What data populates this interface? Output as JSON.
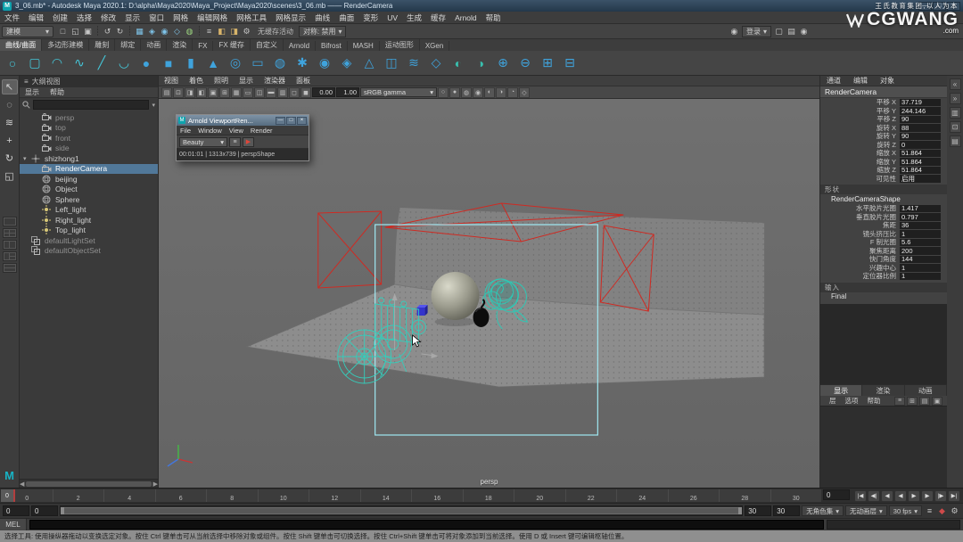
{
  "window": {
    "title": "3_06.mb* - Autodesk Maya 2020.1: D:\\alpha\\Maya2020\\Maya_Project\\Maya2020\\scenes\\3_06.mb —— RenderCamera",
    "badge": "M",
    "buttons": [
      {
        "name": "minimize-button",
        "glyph": "—"
      },
      {
        "name": "maximize-button",
        "glyph": "□"
      },
      {
        "name": "close-button",
        "glyph": "×"
      }
    ]
  },
  "watermark": {
    "line1": "王氏教育集团,以人为本",
    "brand": "CGWANG",
    "domain": ".com"
  },
  "menubar": {
    "items": [
      "文件",
      "编辑",
      "创建",
      "选择",
      "修改",
      "显示",
      "窗口",
      "网格",
      "编辑网格",
      "网格工具",
      "网格显示",
      "曲线",
      "曲面",
      "变形",
      "UV",
      "生成",
      "缓存",
      "Arnold",
      "帮助"
    ]
  },
  "statusline": {
    "mode": "建模",
    "no_cache_label": "无缓存活动",
    "symmetry_label": "对称: 禁用",
    "signin_label": "登录",
    "icons": [
      {
        "name": "new-scene-icon",
        "glyph": "□"
      },
      {
        "name": "open-scene-icon",
        "glyph": "◱"
      },
      {
        "name": "save-scene-icon",
        "glyph": "▣"
      },
      {
        "name": "separator-grip",
        "glyph": "┊"
      },
      {
        "name": "undo-icon",
        "glyph": "↺"
      },
      {
        "name": "redo-icon",
        "glyph": "↻"
      },
      {
        "name": "separator-grip",
        "glyph": "┊"
      },
      {
        "name": "snap-to-grid-icon",
        "glyph": "▦",
        "color": "#7ec3e8"
      },
      {
        "name": "snap-to-curve-icon",
        "glyph": "◈",
        "color": "#7ec3e8"
      },
      {
        "name": "snap-to-point-icon",
        "glyph": "◉",
        "color": "#7ec3e8"
      },
      {
        "name": "snap-to-plane-icon",
        "glyph": "◇",
        "color": "#7ec3e8"
      },
      {
        "name": "make-live-icon",
        "glyph": "◍",
        "color": "#9ad17e"
      },
      {
        "name": "separator-grip",
        "glyph": "┊"
      },
      {
        "name": "construction-history-icon",
        "glyph": "≡"
      },
      {
        "name": "open-render-view-icon",
        "glyph": "◧",
        "color": "#d8b46a"
      },
      {
        "name": "render-current-frame-icon",
        "glyph": "◨",
        "color": "#d8b46a"
      },
      {
        "name": "render-settings-icon",
        "glyph": "⚙"
      }
    ],
    "right_icons": [
      {
        "name": "highlight-selection-icon",
        "glyph": "▢"
      },
      {
        "name": "input-line-icon",
        "glyph": "▤"
      },
      {
        "name": "user-account-icon",
        "glyph": "◉"
      }
    ]
  },
  "shelf": {
    "tabs": [
      {
        "label": "曲线/曲面",
        "active": true
      },
      {
        "label": "多边形建模"
      },
      {
        "label": "雕刻"
      },
      {
        "label": "绑定"
      },
      {
        "label": "动画"
      },
      {
        "label": "渲染"
      },
      {
        "label": "FX"
      },
      {
        "label": "FX 缓存"
      },
      {
        "label": "自定义"
      },
      {
        "label": "Arnold"
      },
      {
        "label": "Bifrost"
      },
      {
        "label": "MASH"
      },
      {
        "label": "运动图形"
      },
      {
        "label": "XGen"
      }
    ],
    "icons": [
      {
        "name": "nurbs-circle-icon",
        "glyph": "○",
        "color": "#45c6d8"
      },
      {
        "name": "nurbs-square-icon",
        "glyph": "▢",
        "color": "#45c6d8"
      },
      {
        "name": "ep-curve-icon",
        "glyph": "◠",
        "color": "#45c6d8"
      },
      {
        "name": "bezier-curve-icon",
        "glyph": "∿",
        "color": "#45c6d8"
      },
      {
        "name": "pencil-curve-icon",
        "glyph": "╱",
        "color": "#45c6d8"
      },
      {
        "name": "arc-tool-icon",
        "glyph": "◡",
        "color": "#45c6d8"
      },
      {
        "name": "poly-sphere-icon",
        "glyph": "●",
        "color": "#3fa3dc"
      },
      {
        "name": "poly-cube-icon",
        "glyph": "■",
        "color": "#3fa3dc"
      },
      {
        "name": "poly-cylinder-icon",
        "glyph": "▮",
        "color": "#3fa3dc"
      },
      {
        "name": "poly-cone-icon",
        "glyph": "▲",
        "color": "#3fa3dc"
      },
      {
        "name": "poly-torus-icon",
        "glyph": "◎",
        "color": "#3fa3dc"
      },
      {
        "name": "poly-plane-icon",
        "glyph": "▭",
        "color": "#3fa3dc"
      },
      {
        "name": "poly-disc-icon",
        "glyph": "◍",
        "color": "#3fa3dc"
      },
      {
        "name": "poly-gear-icon",
        "glyph": "✱",
        "color": "#3fa3dc"
      },
      {
        "name": "poly-soccer-icon",
        "glyph": "◉",
        "color": "#3fa3dc"
      },
      {
        "name": "poly-platonic-icon",
        "glyph": "◈",
        "color": "#3fa3dc"
      },
      {
        "name": "poly-pyramid-icon",
        "glyph": "△",
        "color": "#3fa3dc"
      },
      {
        "name": "poly-pipe-icon",
        "glyph": "◫",
        "color": "#3fa3dc"
      },
      {
        "name": "poly-helix-icon",
        "glyph": "≋",
        "color": "#3fa3dc"
      },
      {
        "name": "poly-prism-icon",
        "glyph": "◇",
        "color": "#3fa3dc"
      },
      {
        "name": "sculpt-tool-icon",
        "glyph": "◐",
        "color": "#39bfae"
      },
      {
        "name": "smooth-tool-icon",
        "glyph": "◑",
        "color": "#39bfae"
      },
      {
        "name": "boolean-union-icon",
        "glyph": "⊕",
        "color": "#3fa3dc"
      },
      {
        "name": "boolean-difference-icon",
        "glyph": "⊖",
        "color": "#3fa3dc"
      },
      {
        "name": "combine-icon",
        "glyph": "⊞",
        "color": "#3fa3dc"
      },
      {
        "name": "separate-icon",
        "glyph": "⊟",
        "color": "#3fa3dc"
      }
    ]
  },
  "toolbox": {
    "tools": [
      {
        "name": "select-tool-icon",
        "glyph": "↖",
        "active": true
      },
      {
        "name": "lasso-tool-icon",
        "glyph": "◌"
      },
      {
        "name": "paint-select-tool-icon",
        "glyph": "≋"
      },
      {
        "name": "move-tool-icon",
        "glyph": "+"
      },
      {
        "name": "rotate-tool-icon",
        "glyph": "↻"
      },
      {
        "name": "scale-tool-icon",
        "glyph": "◱"
      }
    ]
  },
  "outliner": {
    "title": "大纲视图",
    "menus": [
      "显示",
      "帮助"
    ],
    "search_placeholder": "",
    "items": [
      {
        "label": "persp",
        "icon": "camera",
        "depth": 1,
        "dim": true
      },
      {
        "label": "top",
        "icon": "camera",
        "depth": 1,
        "dim": true
      },
      {
        "label": "front",
        "icon": "camera",
        "depth": 1,
        "dim": true
      },
      {
        "label": "side",
        "icon": "camera",
        "depth": 1,
        "dim": true
      },
      {
        "label": "shizhong1",
        "icon": "transform",
        "depth": 0,
        "expander": "▾"
      },
      {
        "label": "RenderCamera",
        "icon": "camera",
        "depth": 1,
        "selected": true
      },
      {
        "label": "beijing",
        "icon": "mesh",
        "depth": 1
      },
      {
        "label": "Object",
        "icon": "mesh",
        "depth": 1
      },
      {
        "label": "Sphere",
        "icon": "mesh",
        "depth": 1
      },
      {
        "label": "Left_light",
        "icon": "light",
        "depth": 1
      },
      {
        "label": "Right_light",
        "icon": "light",
        "depth": 1
      },
      {
        "label": "Top_light",
        "icon": "light",
        "depth": 1
      },
      {
        "label": "defaultLightSet",
        "icon": "set",
        "depth": 0,
        "dim": true
      },
      {
        "label": "defaultObjectSet",
        "icon": "set",
        "depth": 0,
        "dim": true
      }
    ]
  },
  "viewport": {
    "menus": [
      "视图",
      "着色",
      "照明",
      "显示",
      "渲染器",
      "面板"
    ],
    "toolbar_icons_left": [
      {
        "name": "select-camera-icon",
        "glyph": "▤"
      },
      {
        "name": "lock-camera-icon",
        "glyph": "⊡"
      },
      {
        "name": "camera-attributes-icon",
        "glyph": "◨"
      },
      {
        "name": "bookmark-icon",
        "glyph": "◧"
      },
      {
        "name": "image-plane-icon",
        "glyph": "▣"
      },
      {
        "name": "2d-pan-zoom-icon",
        "glyph": "⊞"
      },
      {
        "name": "grid-icon",
        "glyph": "▦"
      },
      {
        "name": "film-gate-icon",
        "glyph": "▭"
      },
      {
        "name": "resolution-gate-icon",
        "glyph": "◫"
      },
      {
        "name": "gate-mask-icon",
        "glyph": "▬"
      },
      {
        "name": "field-chart-icon",
        "glyph": "▥"
      },
      {
        "name": "safe-action-icon",
        "glyph": "◻"
      },
      {
        "name": "safe-title-icon",
        "glyph": "◼"
      }
    ],
    "exposure": "0.00",
    "gamma": "1.00",
    "view_transform": "sRGB gamma",
    "toolbar_icons_right": [
      {
        "name": "wireframe-icon",
        "glyph": "○"
      },
      {
        "name": "shaded-icon",
        "glyph": "●"
      },
      {
        "name": "textured-icon",
        "glyph": "◍"
      },
      {
        "name": "use-all-lights-icon",
        "glyph": "◉"
      },
      {
        "name": "shadows-icon",
        "glyph": "◐"
      },
      {
        "name": "ao-icon",
        "glyph": "◑"
      },
      {
        "name": "motion-blur-icon",
        "glyph": "◔"
      },
      {
        "name": "xray-icon",
        "glyph": "◇"
      }
    ],
    "camera_label": "persp"
  },
  "arnold_window": {
    "title": "Arnold ViewportRen...",
    "menus": [
      "File",
      "Window",
      "View",
      "Render"
    ],
    "aov_label": "Beauty",
    "buttons": [
      {
        "name": "aov-list-button",
        "glyph": "≡"
      },
      {
        "name": "start-render-button",
        "glyph": "▶",
        "color": "#e0463a"
      }
    ],
    "win_buttons": [
      {
        "name": "arnold-minimize-button",
        "glyph": "—"
      },
      {
        "name": "arnold-maximize-button",
        "glyph": "□"
      },
      {
        "name": "arnold-close-button",
        "glyph": "×"
      }
    ],
    "status": "00:01:01 | 1313x739 | perspShape"
  },
  "channel_box": {
    "menus": [
      "通道",
      "编辑",
      "对象"
    ],
    "object_name": "RenderCamera",
    "transform_rows": [
      [
        "平移 X",
        "37.719"
      ],
      [
        "平移 Y",
        "244.146"
      ],
      [
        "平移 Z",
        "90"
      ],
      [
        "旋转 X",
        "88"
      ],
      [
        "旋转 Y",
        "90"
      ],
      [
        "旋转 Z",
        "0"
      ],
      [
        "缩放 X",
        "51.864"
      ],
      [
        "缩放 Y",
        "51.864"
      ],
      [
        "缩放 Z",
        "51.864"
      ],
      [
        "可见性",
        "启用"
      ]
    ],
    "shapes_header": "形状",
    "shape_name": "RenderCameraShape",
    "shape_rows": [
      [
        "水平胶片光圈",
        "1.417"
      ],
      [
        "垂直胶片光圈",
        "0.797"
      ],
      [
        "焦距",
        "36"
      ],
      [
        "镜头挤压比",
        "1"
      ],
      [
        "F 制光圈",
        "5.6"
      ],
      [
        "聚焦距离",
        "200"
      ],
      [
        "快门角度",
        "144"
      ],
      [
        "兴趣中心",
        "1"
      ],
      [
        "定位器比例",
        "1"
      ]
    ],
    "inputs_header": "输入",
    "inputs": [
      "Final"
    ]
  },
  "layer_editor": {
    "tabs": [
      {
        "label": "显示",
        "active": true
      },
      {
        "label": "渲染"
      },
      {
        "label": "动画"
      }
    ],
    "menus": [
      "层",
      "选项",
      "帮助"
    ],
    "icon_buttons": [
      {
        "name": "layer-options-icon",
        "glyph": "≡"
      },
      {
        "name": "new-empty-layer-icon",
        "glyph": "⊞"
      },
      {
        "name": "new-layer-icon",
        "glyph": "▤"
      },
      {
        "name": "new-layer-from-selected-icon",
        "glyph": "▣"
      }
    ]
  },
  "rightstrip": {
    "icons": [
      {
        "name": "collapse-panel-icon",
        "glyph": "«"
      },
      {
        "name": "expand-panel-icon",
        "glyph": "»"
      },
      {
        "name": "channel-box-tab-icon",
        "glyph": "▥"
      },
      {
        "name": "modeling-toolkit-tab-icon",
        "glyph": "⊡"
      },
      {
        "name": "attribute-editor-tab-icon",
        "glyph": "▤"
      }
    ]
  },
  "timeline": {
    "ticks": [
      "0",
      "2",
      "4",
      "6",
      "8",
      "10",
      "12",
      "14",
      "16",
      "18",
      "20",
      "22",
      "24",
      "26",
      "28",
      "30"
    ],
    "current_frame": "0",
    "range_start_outer": "0",
    "range_start_inner": "0",
    "range_end_inner": "30",
    "range_end_outer": "30",
    "character_set_label": "无角色集",
    "anim_layer_label": "无动画层",
    "fps_label": "30 fps",
    "transport": [
      {
        "name": "go-to-start-button",
        "glyph": "|◀"
      },
      {
        "name": "step-back-key-button",
        "glyph": "◀|"
      },
      {
        "name": "step-back-frame-button",
        "glyph": "◀"
      },
      {
        "name": "play-backwards-button",
        "glyph": "◀"
      },
      {
        "name": "play-forwards-button",
        "glyph": "▶"
      },
      {
        "name": "step-forward-frame-button",
        "glyph": "▶"
      },
      {
        "name": "step-forward-key-button",
        "glyph": "|▶"
      },
      {
        "name": "go-to-end-button",
        "glyph": "▶|"
      }
    ],
    "range_icons": [
      {
        "name": "playback-options-icon",
        "glyph": "≡"
      },
      {
        "name": "auto-keyframe-icon",
        "glyph": "◆",
        "color": "#cf4a4a"
      },
      {
        "name": "animation-preferences-icon",
        "glyph": "⚙"
      }
    ]
  },
  "command_line": {
    "label": "MEL"
  },
  "help_line": {
    "text": "选择工具: 使用操纵器拖动以变换选定对象。按住 Ctrl 键单击可从当前选择中移除对象或组件。按住 Shift 键单击可切换选择。按住 Ctrl+Shift 键单击可将对象添加到当前选择。使用 D 或 Insert 键可编辑枢轴位置。"
  }
}
